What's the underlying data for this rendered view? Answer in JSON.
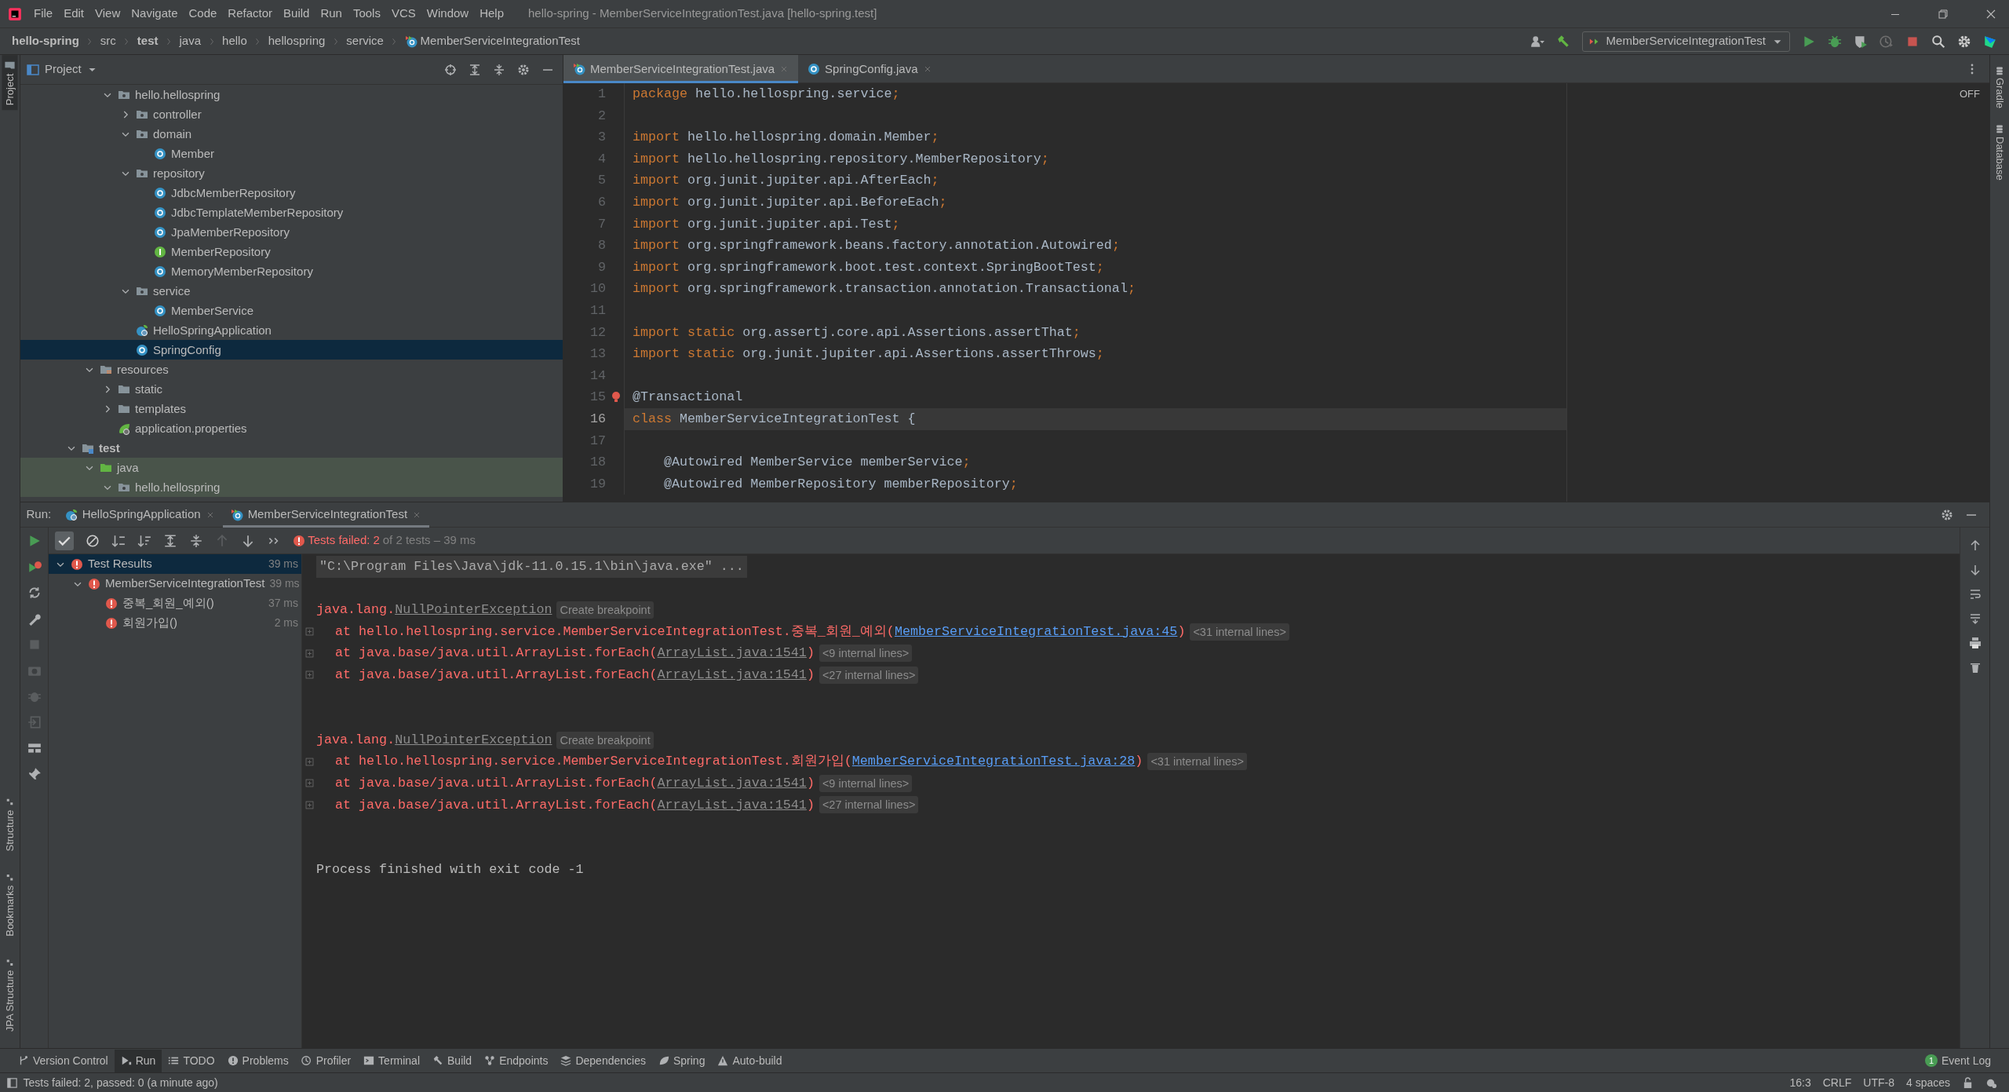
{
  "window": {
    "title": "hello-spring - MemberServiceIntegrationTest.java [hello-spring.test]"
  },
  "menu": [
    "File",
    "Edit",
    "View",
    "Navigate",
    "Code",
    "Refactor",
    "Build",
    "Run",
    "Tools",
    "VCS",
    "Window",
    "Help"
  ],
  "breadcrumb": [
    {
      "label": "hello-spring",
      "bold": true,
      "kind": "path"
    },
    {
      "label": "src",
      "bold": false,
      "kind": "path"
    },
    {
      "label": "test",
      "bold": true,
      "kind": "path"
    },
    {
      "label": "java",
      "bold": false,
      "kind": "path"
    },
    {
      "label": "hello",
      "bold": false,
      "kind": "path"
    },
    {
      "label": "hellospring",
      "bold": false,
      "kind": "path"
    },
    {
      "label": "service",
      "bold": false,
      "kind": "path"
    },
    {
      "label": "MemberServiceIntegrationTest",
      "bold": false,
      "kind": "test-class"
    }
  ],
  "run_configuration": {
    "label": "MemberServiceIntegrationTest"
  },
  "left_strip": {
    "top": [
      "Project"
    ],
    "bottom": [
      "Structure",
      "Bookmarks",
      "JPA Structure"
    ]
  },
  "right_strip": [
    "Gradle",
    "Database"
  ],
  "project_panel": {
    "title": "Project",
    "tree": [
      {
        "children": [
          {
            "children": [
              {
                "label": "hello.hellospring",
                "kind": "package",
                "expanded": true,
                "selected": false,
                "children": [
                  {
                    "label": "controller",
                    "kind": "package",
                    "expanded": false,
                    "selected": false
                  },
                  {
                    "label": "domain",
                    "kind": "package",
                    "expanded": true,
                    "selected": false,
                    "children": [
                      {
                        "label": "Member",
                        "kind": "class",
                        "selected": false
                      }
                    ]
                  },
                  {
                    "label": "repository",
                    "kind": "package",
                    "expanded": true,
                    "selected": false,
                    "children": [
                      {
                        "label": "JdbcMemberRepository",
                        "kind": "class",
                        "selected": false
                      },
                      {
                        "label": "JdbcTemplateMemberRepository",
                        "kind": "class",
                        "selected": false
                      },
                      {
                        "label": "JpaMemberRepository",
                        "kind": "class",
                        "selected": false
                      },
                      {
                        "label": "MemberRepository",
                        "kind": "interface",
                        "selected": false
                      },
                      {
                        "label": "MemoryMemberRepository",
                        "kind": "class",
                        "selected": false
                      }
                    ]
                  },
                  {
                    "label": "service",
                    "kind": "package",
                    "expanded": true,
                    "selected": false,
                    "children": [
                      {
                        "label": "MemberService",
                        "kind": "class",
                        "selected": false
                      }
                    ]
                  },
                  {
                    "label": "HelloSpringApplication",
                    "kind": "spring-app",
                    "selected": false
                  },
                  {
                    "label": "SpringConfig",
                    "kind": "class",
                    "selected": true
                  }
                ]
              }
            ]
          },
          {
            "label": "resources",
            "kind": "resources",
            "expanded": true,
            "selected": false,
            "children": [
              {
                "label": "static",
                "kind": "folder",
                "expanded": false,
                "selected": false
              },
              {
                "label": "templates",
                "kind": "folder",
                "expanded": false,
                "selected": false
              },
              {
                "label": "application.properties",
                "kind": "properties",
                "selected": false
              }
            ]
          }
        ]
      },
      {
        "label": "test",
        "kind": "test-root",
        "bold": true,
        "expanded": true,
        "selected": false,
        "children": [
          {
            "label": "java",
            "kind": "test-sources",
            "expanded": true,
            "selected": false,
            "highlighted": true,
            "children": [
              {
                "label": "hello.hellospring",
                "kind": "package",
                "expanded": true,
                "selected": false,
                "highlighted": true
              }
            ]
          }
        ]
      }
    ]
  },
  "editor": {
    "tabs": [
      {
        "label": "MemberServiceIntegrationTest.java",
        "kind": "test-class",
        "selected": true
      },
      {
        "label": "SpringConfig.java",
        "kind": "class",
        "selected": false
      }
    ],
    "inspection_widget": "OFF",
    "lines": [
      {
        "number": "1",
        "current": false,
        "segments": [
          {
            "text": "package",
            "kind": "keyword"
          },
          {
            "text": " hello.hellospring.service",
            "kind": "plain"
          },
          {
            "text": ";",
            "kind": "keyword"
          }
        ]
      },
      {
        "number": "2",
        "current": false
      },
      {
        "number": "3",
        "current": false,
        "segments": [
          {
            "text": "import",
            "kind": "keyword"
          },
          {
            "text": " hello.hellospring.domain.Member",
            "kind": "plain"
          },
          {
            "text": ";",
            "kind": "keyword"
          }
        ]
      },
      {
        "number": "4",
        "current": false,
        "segments": [
          {
            "text": "import",
            "kind": "keyword"
          },
          {
            "text": " hello.hellospring.repository.MemberRepository",
            "kind": "plain"
          },
          {
            "text": ";",
            "kind": "keyword"
          }
        ]
      },
      {
        "number": "5",
        "current": false,
        "segments": [
          {
            "text": "import",
            "kind": "keyword"
          },
          {
            "text": " org.junit.jupiter.api.AfterEach",
            "kind": "plain"
          },
          {
            "text": ";",
            "kind": "keyword"
          }
        ]
      },
      {
        "number": "6",
        "current": false,
        "segments": [
          {
            "text": "import",
            "kind": "keyword"
          },
          {
            "text": " org.junit.jupiter.api.BeforeEach",
            "kind": "plain"
          },
          {
            "text": ";",
            "kind": "keyword"
          }
        ]
      },
      {
        "number": "7",
        "current": false,
        "segments": [
          {
            "text": "import",
            "kind": "keyword"
          },
          {
            "text": " org.junit.jupiter.api.Test",
            "kind": "plain"
          },
          {
            "text": ";",
            "kind": "keyword"
          }
        ]
      },
      {
        "number": "8",
        "current": false,
        "segments": [
          {
            "text": "import",
            "kind": "keyword"
          },
          {
            "text": " org.springframework.beans.factory.annotation.Autowired",
            "kind": "plain"
          },
          {
            "text": ";",
            "kind": "keyword"
          }
        ]
      },
      {
        "number": "9",
        "current": false,
        "segments": [
          {
            "text": "import",
            "kind": "keyword"
          },
          {
            "text": " org.springframework.boot.test.context.SpringBootTest",
            "kind": "plain"
          },
          {
            "text": ";",
            "kind": "keyword"
          }
        ]
      },
      {
        "number": "10",
        "current": false,
        "segments": [
          {
            "text": "import",
            "kind": "keyword"
          },
          {
            "text": " org.springframework.transaction.annotation.Transactional",
            "kind": "plain"
          },
          {
            "text": ";",
            "kind": "keyword"
          }
        ]
      },
      {
        "number": "11",
        "current": false
      },
      {
        "number": "12",
        "current": false,
        "segments": [
          {
            "text": "import static",
            "kind": "keyword"
          },
          {
            "text": " org.assertj.core.api.Assertions.assertThat",
            "kind": "plain"
          },
          {
            "text": ";",
            "kind": "keyword"
          }
        ]
      },
      {
        "number": "13",
        "current": false,
        "segments": [
          {
            "text": "import static",
            "kind": "keyword"
          },
          {
            "text": " org.junit.jupiter.api.Assertions.assertThrows",
            "kind": "plain"
          },
          {
            "text": ";",
            "kind": "keyword"
          }
        ]
      },
      {
        "number": "14",
        "current": false
      },
      {
        "number": "15",
        "current": false,
        "bulb": true,
        "segments": [
          {
            "text": "@Transactional",
            "kind": "plain"
          }
        ]
      },
      {
        "number": "16",
        "current": true,
        "segments": [
          {
            "text": "class",
            "kind": "keyword"
          },
          {
            "text": " MemberServiceIntegrationTest {",
            "kind": "plain"
          }
        ]
      },
      {
        "number": "17",
        "current": false
      },
      {
        "number": "18",
        "current": false,
        "segments": [
          {
            "text": "    @Autowired MemberService memberService",
            "kind": "plain"
          },
          {
            "text": ";",
            "kind": "keyword"
          }
        ]
      },
      {
        "number": "19",
        "current": false,
        "segments": [
          {
            "text": "    @Autowired MemberRepository memberRepository",
            "kind": "plain"
          },
          {
            "text": ";",
            "kind": "keyword"
          }
        ]
      }
    ]
  },
  "run_panel": {
    "label": "Run:",
    "tabs": [
      {
        "label": "HelloSpringApplication",
        "kind": "spring-app",
        "selected": false
      },
      {
        "label": "MemberServiceIntegrationTest",
        "kind": "test-class",
        "selected": true
      }
    ],
    "status": {
      "headline": "Tests failed: 2",
      "detail": "of 2 tests – 39 ms"
    },
    "tests": [
      {
        "label": "Test Results",
        "time": "39 ms",
        "kind": "failed",
        "expanded": true,
        "selected": true,
        "children": [
          {
            "label": "MemberServiceIntegrationTest",
            "time": "39 ms",
            "kind": "failed",
            "expanded": true,
            "selected": false,
            "children": [
              {
                "label": "중복_회원_예외()",
                "time": "37 ms",
                "kind": "failed",
                "selected": false
              },
              {
                "label": "회원가입()",
                "time": "2 ms",
                "kind": "failed",
                "selected": false
              }
            ]
          }
        ]
      }
    ],
    "console": [
      {
        "kind": "command",
        "segments": [
          {
            "text": "\"C:\\Program Files\\Java\\jdk-11.0.15.1\\bin\\java.exe\" ...",
            "kind": "text"
          }
        ]
      },
      {
        "kind": "blank"
      },
      {
        "kind": "exception",
        "segments": [
          {
            "text": "java.lang.",
            "kind": "text"
          },
          {
            "text": "NullPointerException",
            "kind": "library-link"
          },
          {
            "text": "Create breakpoint",
            "kind": "hint"
          }
        ]
      },
      {
        "kind": "stack",
        "segments": [
          {
            "text": "at hello.hellospring.service.MemberServiceIntegrationTest.중복_회원_예외(",
            "kind": "text"
          },
          {
            "text": "MemberServiceIntegrationTest.java:45",
            "kind": "link"
          },
          {
            "text": ")",
            "kind": "text"
          },
          {
            "text": "<31 internal lines>",
            "kind": "hint"
          }
        ]
      },
      {
        "kind": "stack",
        "segments": [
          {
            "text": "at java.base/java.util.ArrayList.forEach(",
            "kind": "text"
          },
          {
            "text": "ArrayList.java:1541",
            "kind": "library-link"
          },
          {
            "text": ")",
            "kind": "text"
          },
          {
            "text": "<9 internal lines>",
            "kind": "hint"
          }
        ]
      },
      {
        "kind": "stack",
        "segments": [
          {
            "text": "at java.base/java.util.ArrayList.forEach(",
            "kind": "text"
          },
          {
            "text": "ArrayList.java:1541",
            "kind": "library-link"
          },
          {
            "text": ")",
            "kind": "text"
          },
          {
            "text": "<27 internal lines>",
            "kind": "hint"
          }
        ]
      },
      {
        "kind": "blank"
      },
      {
        "kind": "blank"
      },
      {
        "kind": "exception",
        "segments": [
          {
            "text": "java.lang.",
            "kind": "text"
          },
          {
            "text": "NullPointerException",
            "kind": "library-link"
          },
          {
            "text": "Create breakpoint",
            "kind": "hint"
          }
        ]
      },
      {
        "kind": "stack",
        "segments": [
          {
            "text": "at hello.hellospring.service.MemberServiceIntegrationTest.회원가입(",
            "kind": "text"
          },
          {
            "text": "MemberServiceIntegrationTest.java:28",
            "kind": "link"
          },
          {
            "text": ")",
            "kind": "text"
          },
          {
            "text": "<31 internal lines>",
            "kind": "hint"
          }
        ]
      },
      {
        "kind": "stack",
        "segments": [
          {
            "text": "at java.base/java.util.ArrayList.forEach(",
            "kind": "text"
          },
          {
            "text": "ArrayList.java:1541",
            "kind": "library-link"
          },
          {
            "text": ")",
            "kind": "text"
          },
          {
            "text": "<9 internal lines>",
            "kind": "hint"
          }
        ]
      },
      {
        "kind": "stack",
        "segments": [
          {
            "text": "at java.base/java.util.ArrayList.forEach(",
            "kind": "text"
          },
          {
            "text": "ArrayList.java:1541",
            "kind": "library-link"
          },
          {
            "text": ")",
            "kind": "text"
          },
          {
            "text": "<27 internal lines>",
            "kind": "hint"
          }
        ]
      },
      {
        "kind": "blank"
      },
      {
        "kind": "blank"
      },
      {
        "kind": "plain",
        "segments": [
          {
            "text": "Process finished with exit code -1",
            "kind": "text"
          }
        ]
      }
    ]
  },
  "tool_windows": [
    {
      "label": "Version Control",
      "kind": "vcs",
      "selected": false
    },
    {
      "label": "Run",
      "kind": "run",
      "selected": true
    },
    {
      "label": "TODO",
      "kind": "list",
      "selected": false
    },
    {
      "label": "Problems",
      "kind": "problems",
      "selected": false
    },
    {
      "label": "Profiler",
      "kind": "profiler",
      "selected": false
    },
    {
      "label": "Terminal",
      "kind": "terminal",
      "selected": false
    },
    {
      "label": "Build",
      "kind": "hammer",
      "selected": false
    },
    {
      "label": "Endpoints",
      "kind": "endpoints",
      "selected": false
    },
    {
      "label": "Dependencies",
      "kind": "stack",
      "selected": false
    },
    {
      "label": "Spring",
      "kind": "leaf",
      "selected": false
    },
    {
      "label": "Auto-build",
      "kind": "warning",
      "selected": false
    }
  ],
  "event_log": {
    "label": "Event Log",
    "count": "1"
  },
  "status_bar": {
    "message": "Tests failed: 2, passed: 0 (a minute ago)",
    "items": [
      "16:3",
      "CRLF",
      "UTF-8",
      "4 spaces"
    ]
  }
}
